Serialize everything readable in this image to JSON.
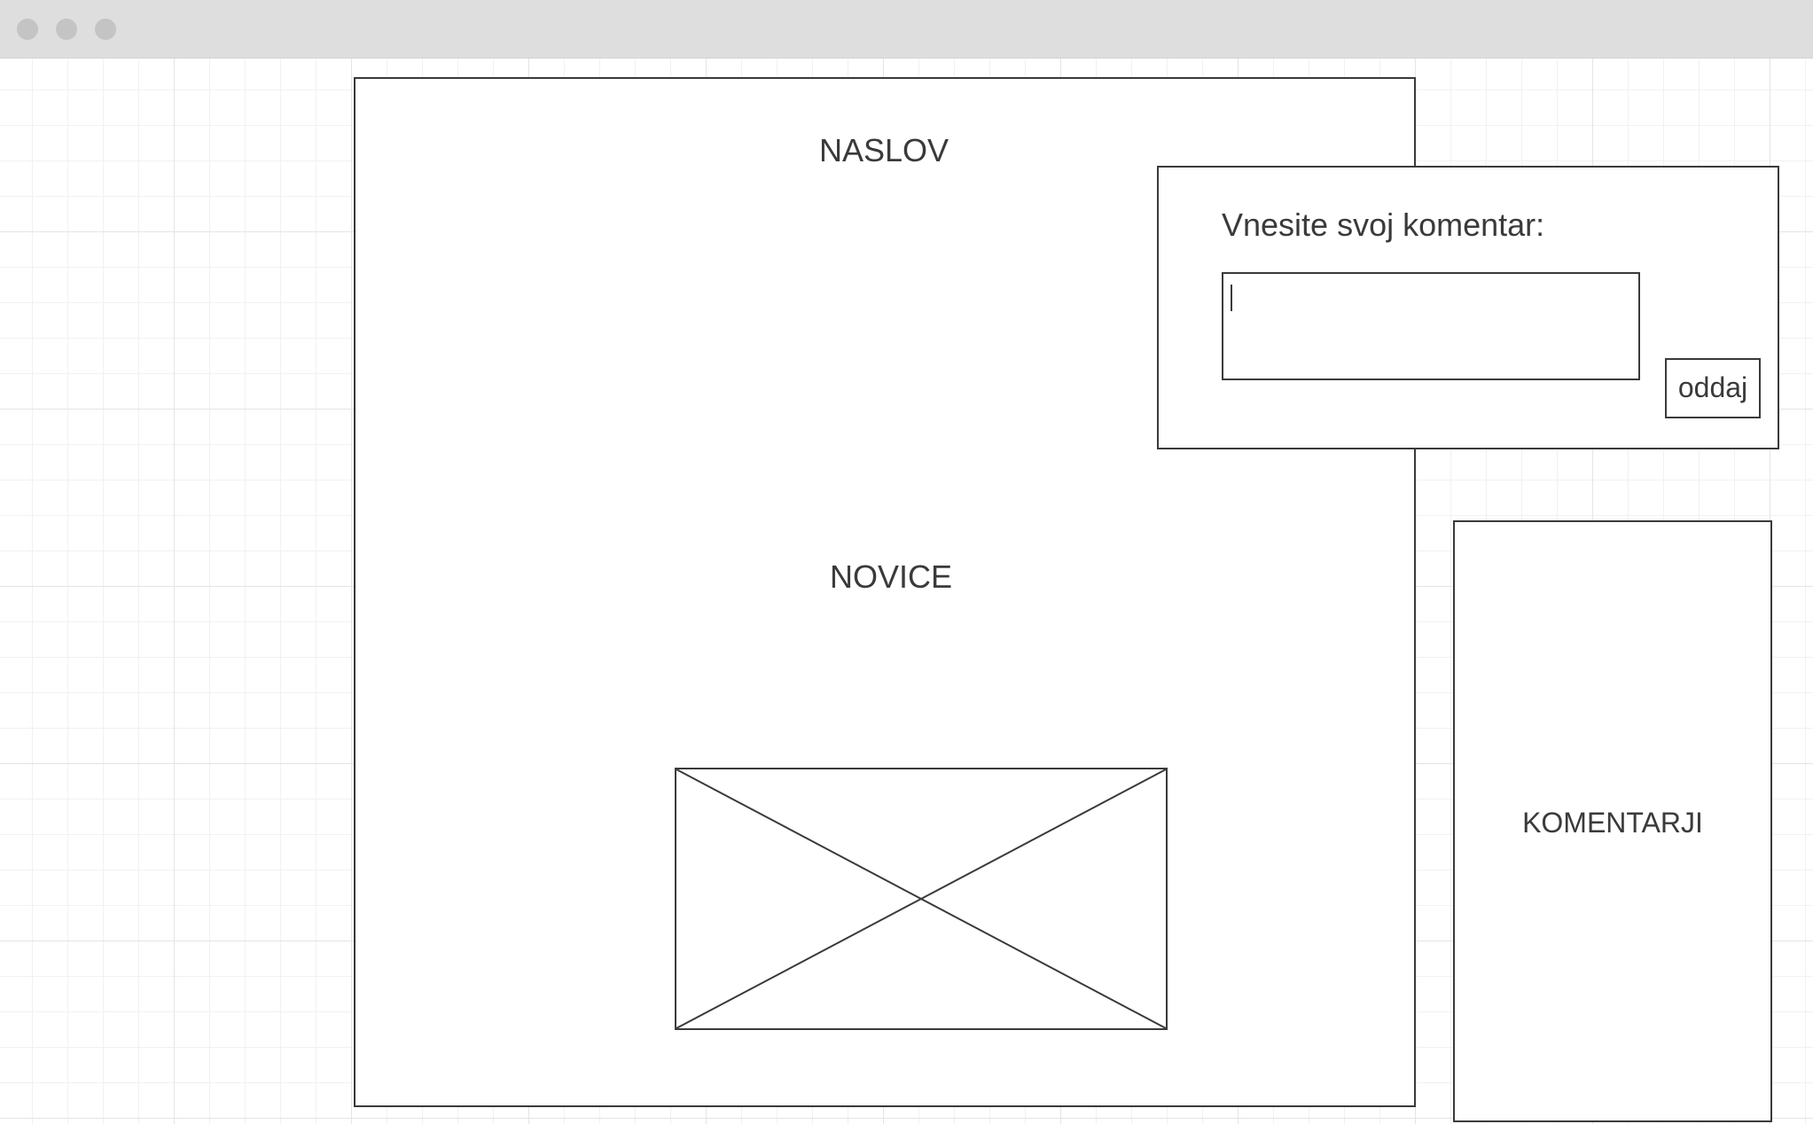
{
  "window": {
    "controls": [
      "close-dot",
      "minimize-dot",
      "maximize-dot"
    ]
  },
  "main": {
    "title": "NASLOV",
    "news_label": "NOVICE"
  },
  "comment_form": {
    "prompt": "Vnesite svoj komentar:",
    "input_value": "",
    "submit_label": "oddaj"
  },
  "comments": {
    "label": "KOMENTARJI"
  },
  "colors": {
    "stroke": "#3a3a3a",
    "titlebar": "#dedede",
    "window_dot": "#c4c4c4",
    "grid_line": "#e4e4e4",
    "background": "#ffffff"
  }
}
